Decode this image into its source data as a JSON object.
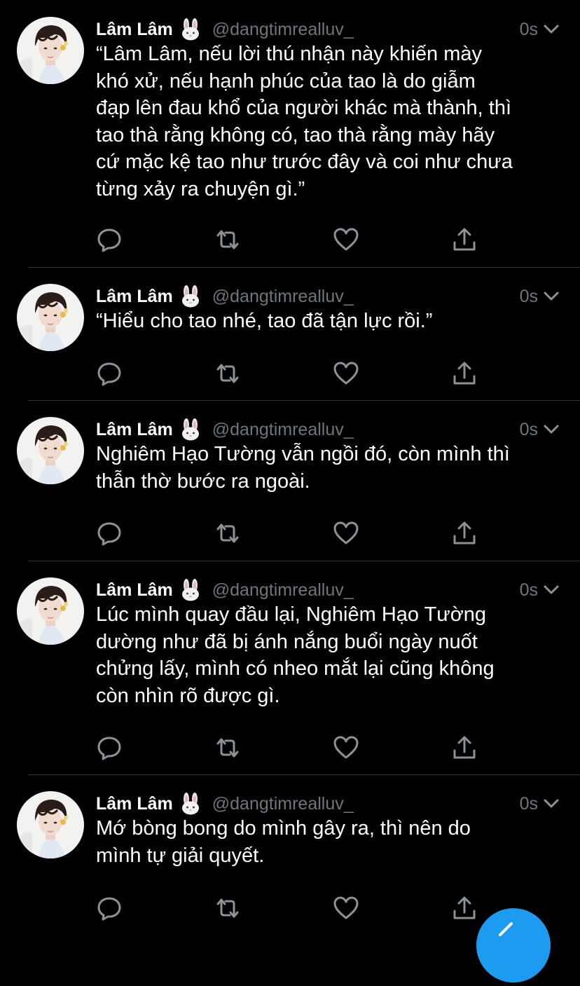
{
  "accent_color": "#1d9bf0",
  "tweets": [
    {
      "author_name": "Lâm Lâm",
      "author_emoji": "rabbit-face-icon",
      "handle": "@dangtimrealluv_",
      "time": "0s",
      "lines": [
        "“Lâm Lâm, nếu lời thú nhận này khiến mày",
        "khó xử, nếu hạnh phúc của tao là do giẫm",
        "đạp lên đau khổ của người khác mà thành, thì",
        "tao thà rằng không có, tao thà rằng mày hãy",
        "cứ mặc kệ tao như trước đây và coi như chưa",
        "từng xảy ra chuyện gì.”"
      ]
    },
    {
      "author_name": "Lâm Lâm",
      "author_emoji": "rabbit-face-icon",
      "handle": "@dangtimrealluv_",
      "time": "0s",
      "lines": [
        "“Hiểu cho tao nhé, tao đã tận lực rồi.”"
      ]
    },
    {
      "author_name": "Lâm Lâm",
      "author_emoji": "rabbit-face-icon",
      "handle": "@dangtimrealluv_",
      "time": "0s",
      "lines": [
        "Nghiêm Hạo Tường vẫn ngồi đó, còn mình thì",
        "thẫn thờ bước ra ngoài."
      ]
    },
    {
      "author_name": "Lâm Lâm",
      "author_emoji": "rabbit-face-icon",
      "handle": "@dangtimrealluv_",
      "time": "0s",
      "lines": [
        "Lúc mình quay đầu lại, Nghiêm Hạo Tường",
        "dường như đã bị ánh nắng buổi ngày nuốt",
        "chửng lấy, mình có nheo mắt lại cũng không",
        "còn nhìn rõ được gì."
      ]
    },
    {
      "author_name": "Lâm Lâm",
      "author_emoji": "rabbit-face-icon",
      "handle": "@dangtimrealluv_",
      "time": "0s",
      "lines": [
        "Mớ bòng bong do mình gây ra, thì nên do",
        "mình tự giải quyết."
      ]
    }
  ]
}
